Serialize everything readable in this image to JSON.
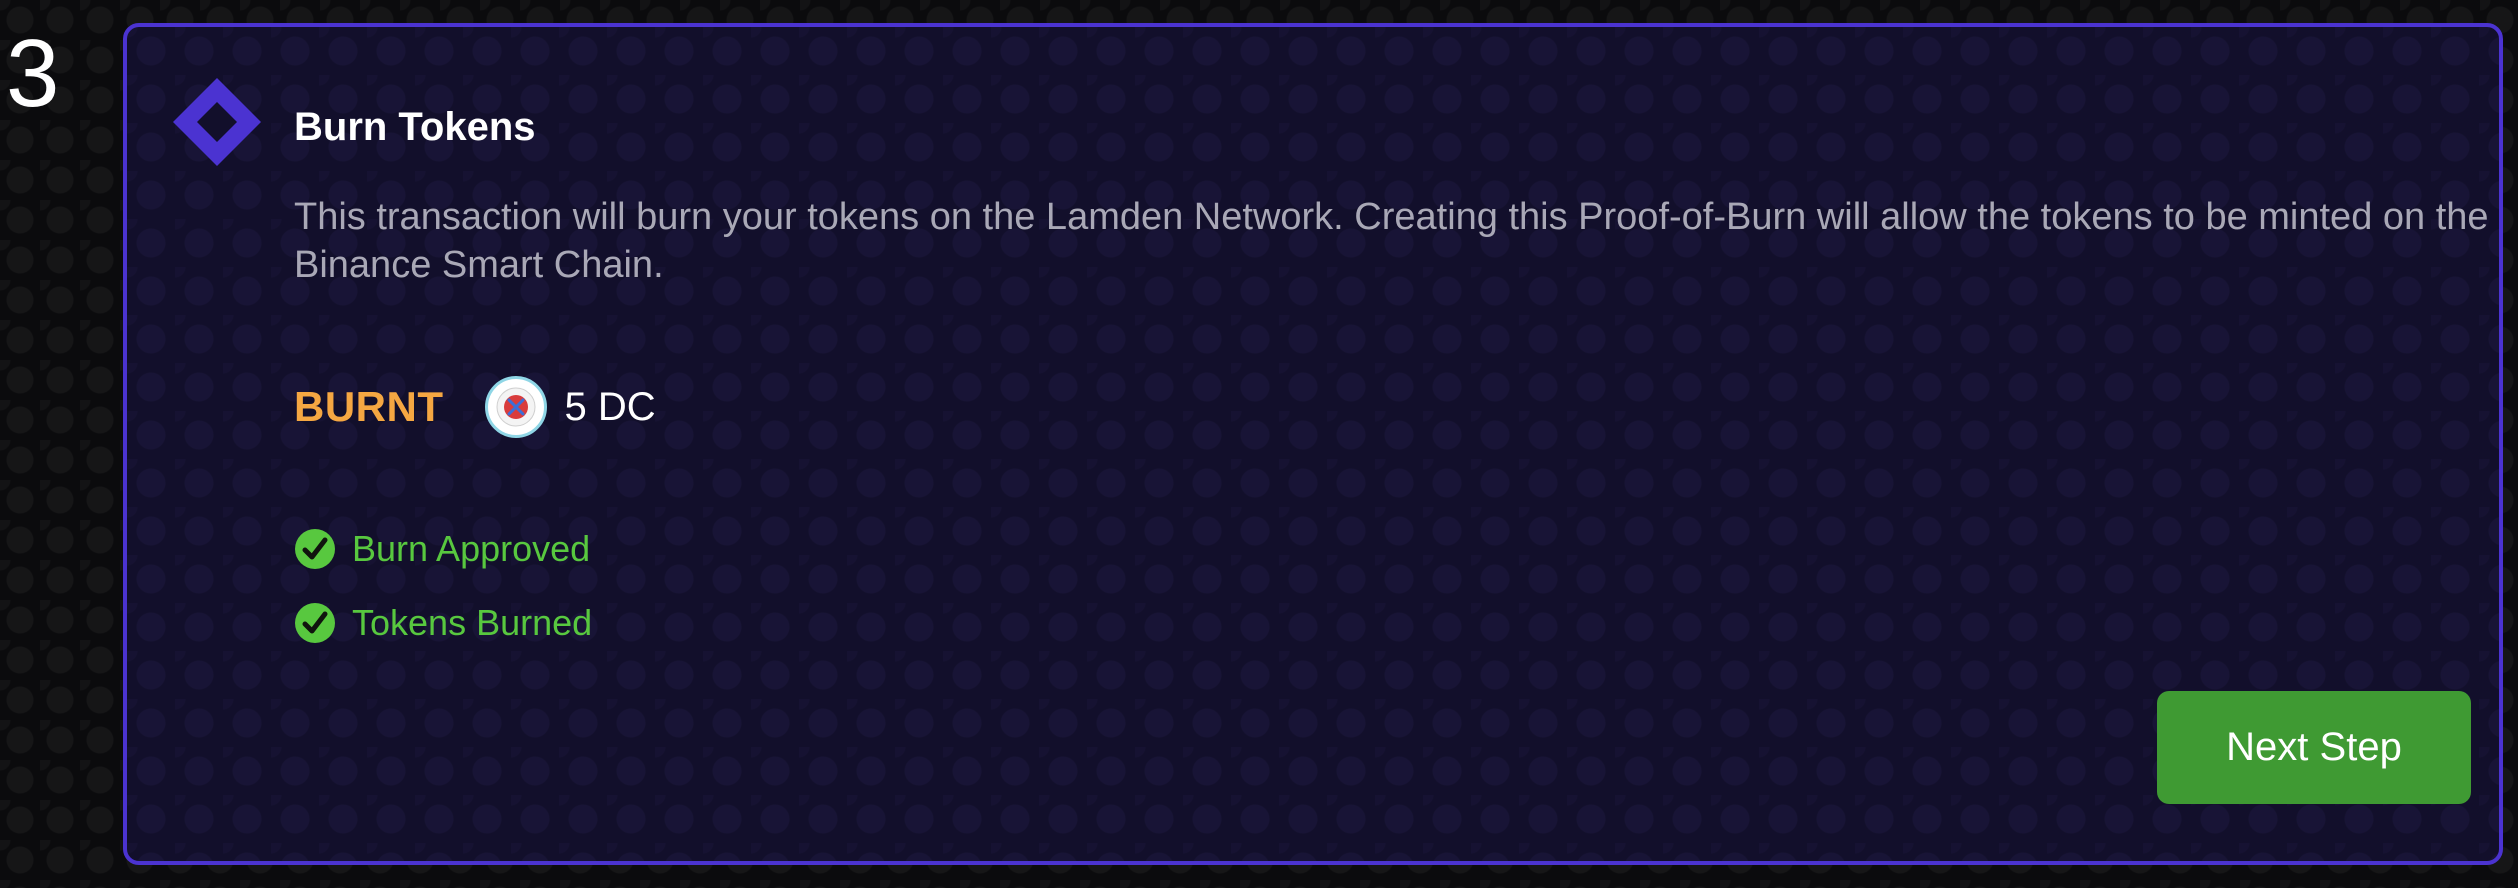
{
  "step": {
    "number": "3"
  },
  "card": {
    "title": "Burn Tokens",
    "description": "This transaction will burn your tokens on the Lamden Network. Creating this Proof-of-Burn will allow the tokens to be minted on the Binance Smart Chain.",
    "icon": "diamond-logo-icon"
  },
  "burn": {
    "label": "BURNT",
    "amount": "5 DC",
    "token_icon": "token-coin-icon"
  },
  "status": [
    {
      "label": "Burn Approved",
      "icon": "check-circle-icon"
    },
    {
      "label": "Tokens Burned",
      "icon": "check-circle-icon"
    }
  ],
  "actions": {
    "next_label": "Next Step"
  },
  "colors": {
    "accent": "#4b33d1",
    "burnt": "#f5a742",
    "success": "#58c83f",
    "button": "#3f9a33",
    "description": "#a9a8b6"
  }
}
